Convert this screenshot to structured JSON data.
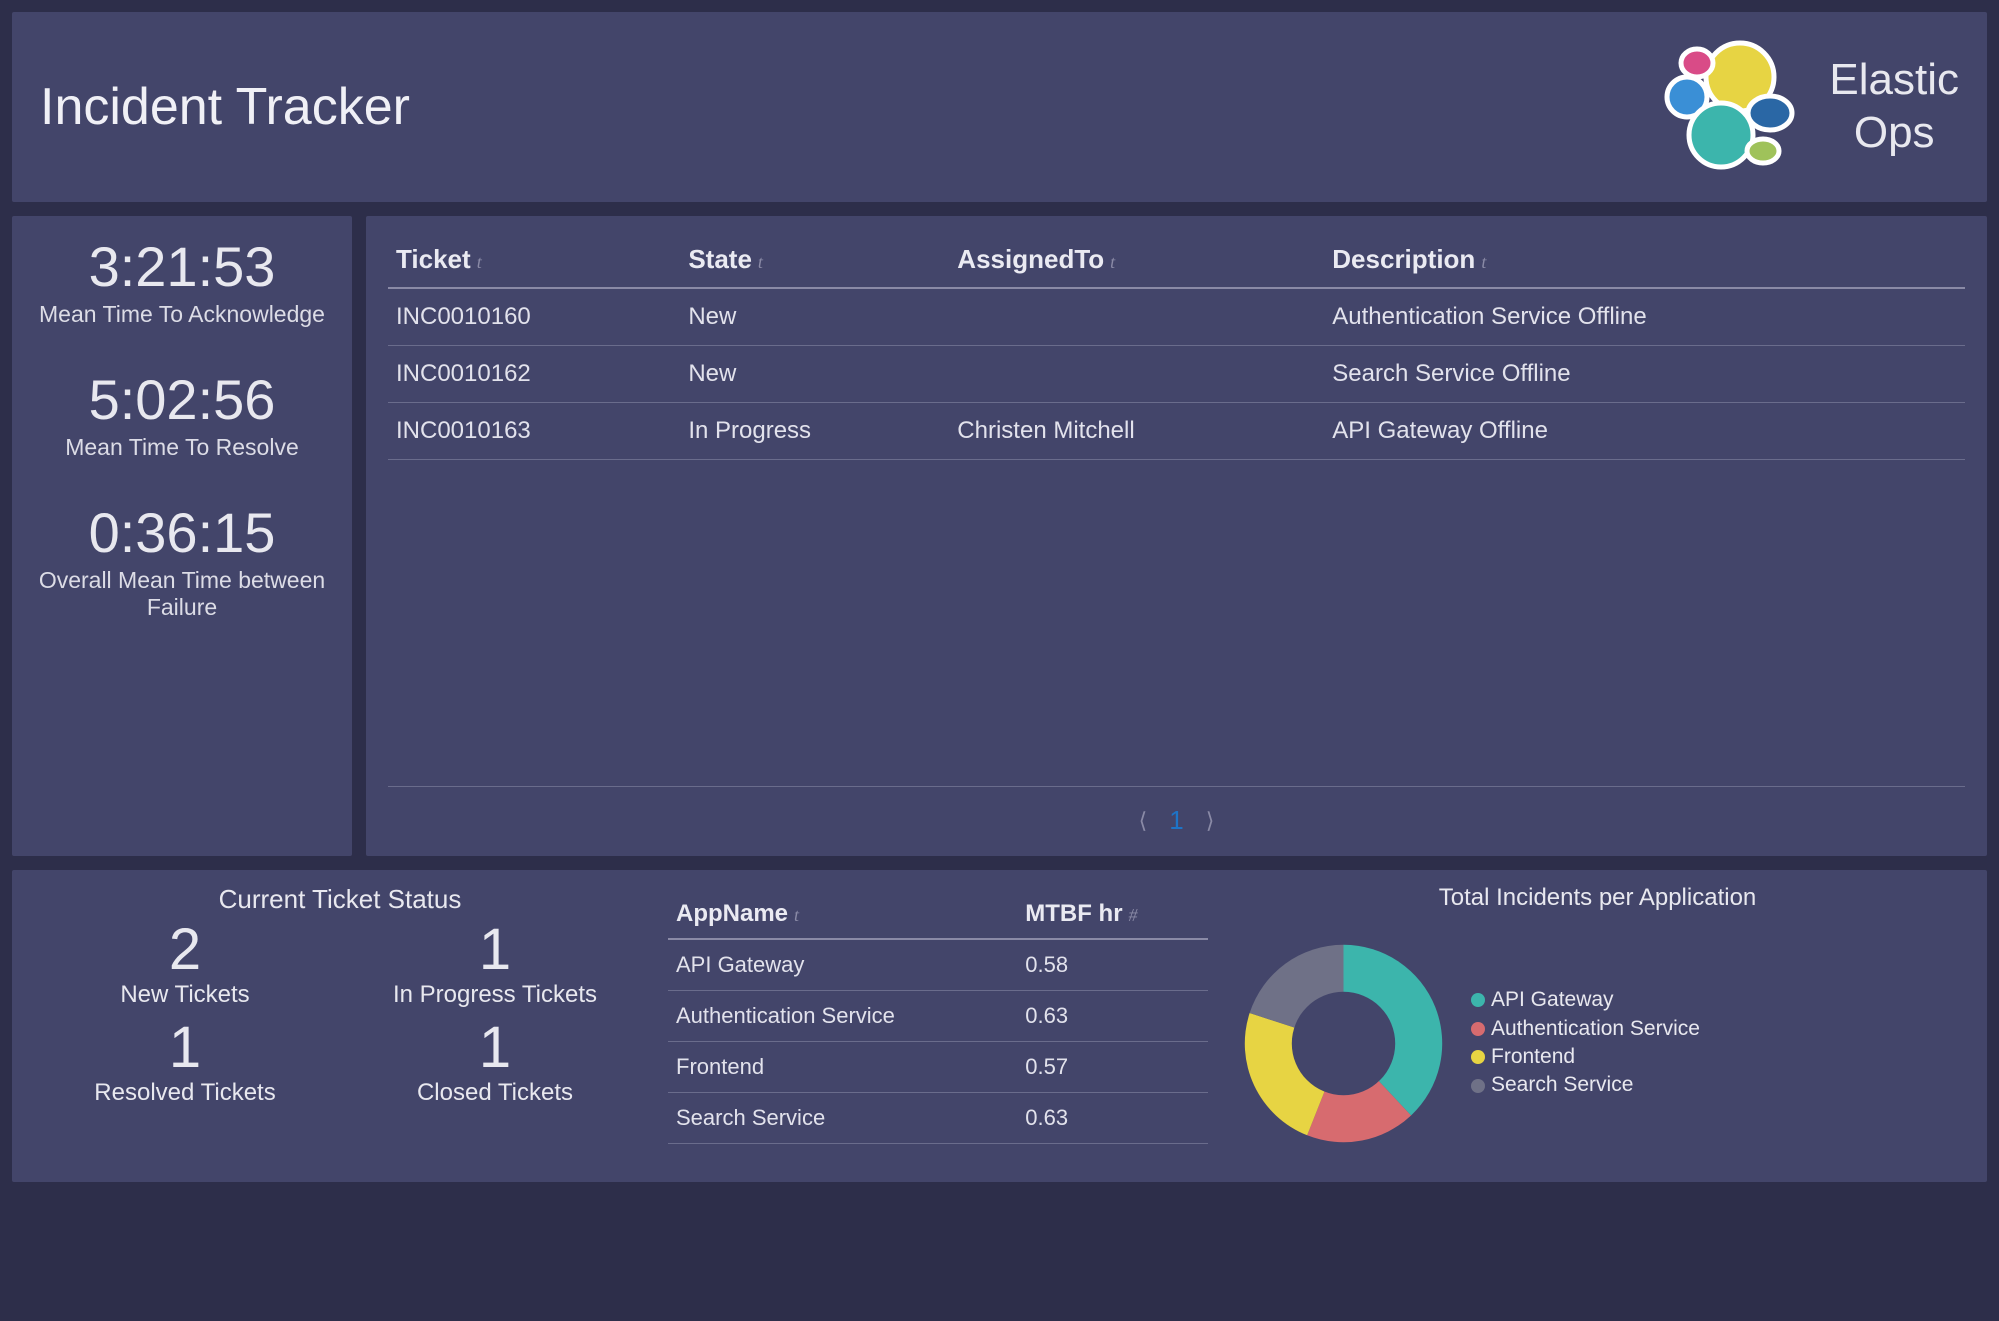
{
  "header": {
    "title": "Incident Tracker",
    "brand_line1": "Elastic",
    "brand_line2": "Ops"
  },
  "metrics": [
    {
      "value": "3:21:53",
      "label": "Mean Time To Acknowledge"
    },
    {
      "value": "5:02:56",
      "label": "Mean Time To Resolve"
    },
    {
      "value": "0:36:15",
      "label": "Overall Mean Time between Failure"
    }
  ],
  "tickets": {
    "columns": {
      "c0": "Ticket",
      "c1": "State",
      "c2": "AssignedTo",
      "c3": "Description"
    },
    "type_glyph": "t",
    "rows": [
      {
        "ticket": "INC0010160",
        "state": "New",
        "assigned": "",
        "desc": "Authentication Service Offline"
      },
      {
        "ticket": "INC0010162",
        "state": "New",
        "assigned": "",
        "desc": "Search Service Offline"
      },
      {
        "ticket": "INC0010163",
        "state": "In Progress",
        "assigned": "Christen Mitchell",
        "desc": "API Gateway Offline"
      }
    ],
    "pager": {
      "current": "1"
    }
  },
  "status": {
    "title": "Current Ticket Status",
    "cells": [
      {
        "value": "2",
        "label": "New Tickets"
      },
      {
        "value": "1",
        "label": "In Progress Tickets"
      },
      {
        "value": "1",
        "label": "Resolved Tickets"
      },
      {
        "value": "1",
        "label": "Closed Tickets"
      }
    ]
  },
  "mtbf": {
    "columns": {
      "c0": "AppName",
      "c1": "MTBF hr"
    },
    "type_glyph_text": "t",
    "type_glyph_num": "#",
    "rows": [
      {
        "app": "API Gateway",
        "hr": "0.58"
      },
      {
        "app": "Authentication Service",
        "hr": "0.63"
      },
      {
        "app": "Frontend",
        "hr": "0.57"
      },
      {
        "app": "Search Service",
        "hr": "0.63"
      }
    ]
  },
  "chart": {
    "title": "Total Incidents per Application",
    "legend": [
      {
        "label": "API Gateway",
        "color": "#3cb5ac"
      },
      {
        "label": "Authentication Service",
        "color": "#d76b6f"
      },
      {
        "label": "Frontend",
        "color": "#e7d443"
      },
      {
        "label": "Search Service",
        "color": "#6f7187"
      }
    ]
  },
  "chart_data": {
    "type": "pie",
    "title": "Total Incidents per Application",
    "series": [
      {
        "name": "API Gateway",
        "value": 38,
        "color": "#3cb5ac"
      },
      {
        "name": "Authentication Service",
        "value": 18,
        "color": "#d76b6f"
      },
      {
        "name": "Frontend",
        "value": 24,
        "color": "#e7d443"
      },
      {
        "name": "Search Service",
        "value": 20,
        "color": "#6f7187"
      }
    ],
    "donut": true
  }
}
